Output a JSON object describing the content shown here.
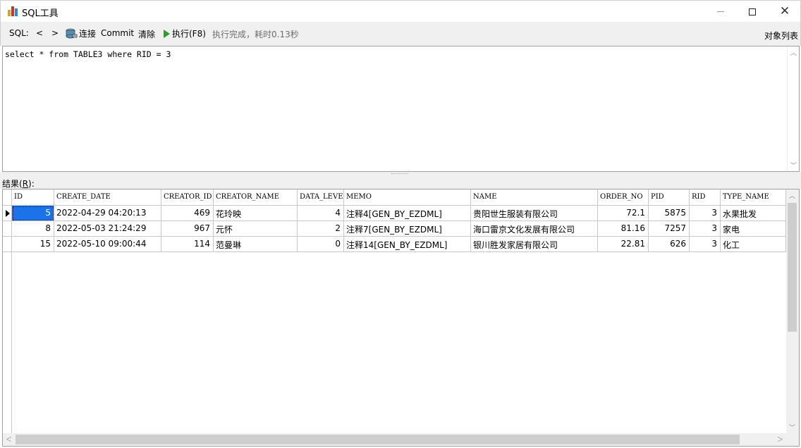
{
  "window": {
    "title": "SQL工具",
    "colors": {
      "icon_bar1": "#d9a323",
      "icon_bar2": "#c0392b",
      "icon_bar3": "#2e86de"
    }
  },
  "toolbar": {
    "sql_label": "SQL:",
    "prev_label": "<",
    "next_label": ">",
    "connect_label": "连接",
    "commit_label": "Commit",
    "clear_label": "清除",
    "execute_label": "执行(F8)",
    "status_text": "执行完成，耗时0.13秒",
    "object_list_label": "对象列表"
  },
  "editor": {
    "sql_text": "select * from TABLE3 where RID = 3"
  },
  "results": {
    "label_prefix": "结果(",
    "label_key": "R",
    "label_suffix": "):",
    "columns": [
      "ID",
      "CREATE_DATE",
      "CREATOR_ID",
      "CREATOR_NAME",
      "DATA_LEVEL",
      "MEMO",
      "NAME",
      "ORDER_NO",
      "PID",
      "RID",
      "TYPE_NAME"
    ],
    "rows": [
      [
        "5",
        "2022-04-29 04:20:13",
        "469",
        "花玲映",
        "4",
        "注释4[GEN_BY_EZDML]",
        "贵阳世生服装有限公司",
        "72.1",
        "5875",
        "3",
        "水果批发"
      ],
      [
        "8",
        "2022-05-03 21:24:29",
        "967",
        "元怀",
        "2",
        "注释7[GEN_BY_EZDML]",
        "海口雷京文化发展有限公司",
        "81.16",
        "7257",
        "3",
        "家电"
      ],
      [
        "15",
        "2022-05-10 09:00:44",
        "114",
        "范曼琳",
        "0",
        "注释14[GEN_BY_EZDML]",
        "银川胜发家居有限公司",
        "22.81",
        "626",
        "3",
        "化工"
      ]
    ],
    "selected_color": "#1a73e8"
  }
}
